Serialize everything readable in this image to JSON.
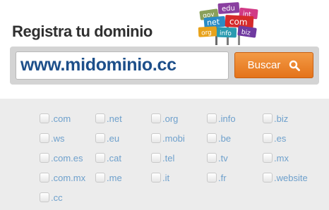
{
  "title": "Registra tu dominio",
  "signs": [
    "gov",
    "edu",
    "int",
    "net",
    "com",
    "org",
    "info",
    "biz"
  ],
  "search": {
    "value": "www.midominio.cc",
    "button_label": "Buscar"
  },
  "extensions": [
    [
      ".com",
      ".net",
      ".org",
      ".info",
      ".biz"
    ],
    [
      ".ws",
      ".eu",
      ".mobi",
      ".be",
      ".es"
    ],
    [
      ".com.es",
      ".cat",
      ".tel",
      ".tv",
      ".mx"
    ],
    [
      ".com.mx",
      ".me",
      ".it",
      ".fr",
      ".website"
    ],
    [
      ".cc"
    ]
  ],
  "colors": {
    "button": "#ec8428",
    "domain_text": "#1d4f8a",
    "extension_text": "#6ea0cc"
  }
}
